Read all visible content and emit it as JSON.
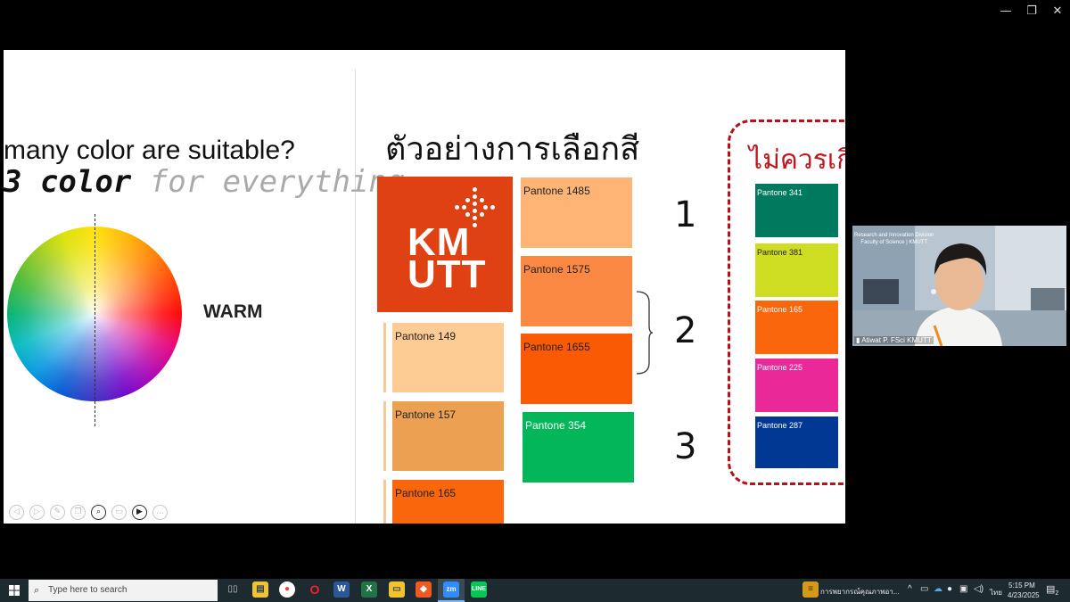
{
  "window": {
    "minimize": "—",
    "restore": "❐",
    "close": "✕"
  },
  "slide": {
    "question": "many color are suitable?",
    "subtitle_bold": "3 color",
    "subtitle_light": " for everything",
    "warm_label": "WARM",
    "thai_title": "ตัวอย่างการเลือกสี",
    "red_title": "ไม่ควรเกิน",
    "logo_line1": "KM",
    "logo_line2": "UTT",
    "column_left": [
      {
        "label": "Pantone 149",
        "color": "#fdcb94"
      },
      {
        "label": "Pantone 157",
        "color": "#eca052"
      },
      {
        "label": "Pantone 165",
        "color": "#f9660c"
      }
    ],
    "column_mid": [
      {
        "label": "Pantone 1485",
        "color": "#fdb474"
      },
      {
        "label": "Pantone 1575",
        "color": "#fb8944"
      },
      {
        "label": "Pantone 1655",
        "color": "#fa5a04"
      },
      {
        "label": "Pantone 354",
        "color": "#02b659"
      }
    ],
    "numbers": [
      "1",
      "2",
      "3"
    ],
    "column_right": [
      {
        "label": "Pantone 341",
        "color": "#007a5e"
      },
      {
        "label": "Pantone 381",
        "color": "#cedc22"
      },
      {
        "label": "Pantone 165",
        "color": "#f9660c"
      },
      {
        "label": "Pantone 225",
        "color": "#eb2898"
      },
      {
        "label": "Pantone 287",
        "color": "#003893"
      }
    ],
    "playback_tools": [
      "prev-icon",
      "next-icon",
      "pen-icon",
      "copy-icon",
      "zoom-icon",
      "subtitle-icon",
      "video-icon",
      "more-icon"
    ]
  },
  "webcam": {
    "header_line1": "Research and Innovation Division",
    "header_line2": "Faculty of Science | KMUTT",
    "participant_name": "Atiwat P. FSci KMUTT"
  },
  "taskbar": {
    "search_placeholder": "Type here to search",
    "notification_title": "การพยากรณ์คุณภาพอา...",
    "language": "ไทย",
    "time": "5:15 PM",
    "date": "4/23/2025",
    "notification_count": "2"
  },
  "colors": {
    "kmutt_orange": "#e04112",
    "dashed_red": "#b5121b"
  }
}
